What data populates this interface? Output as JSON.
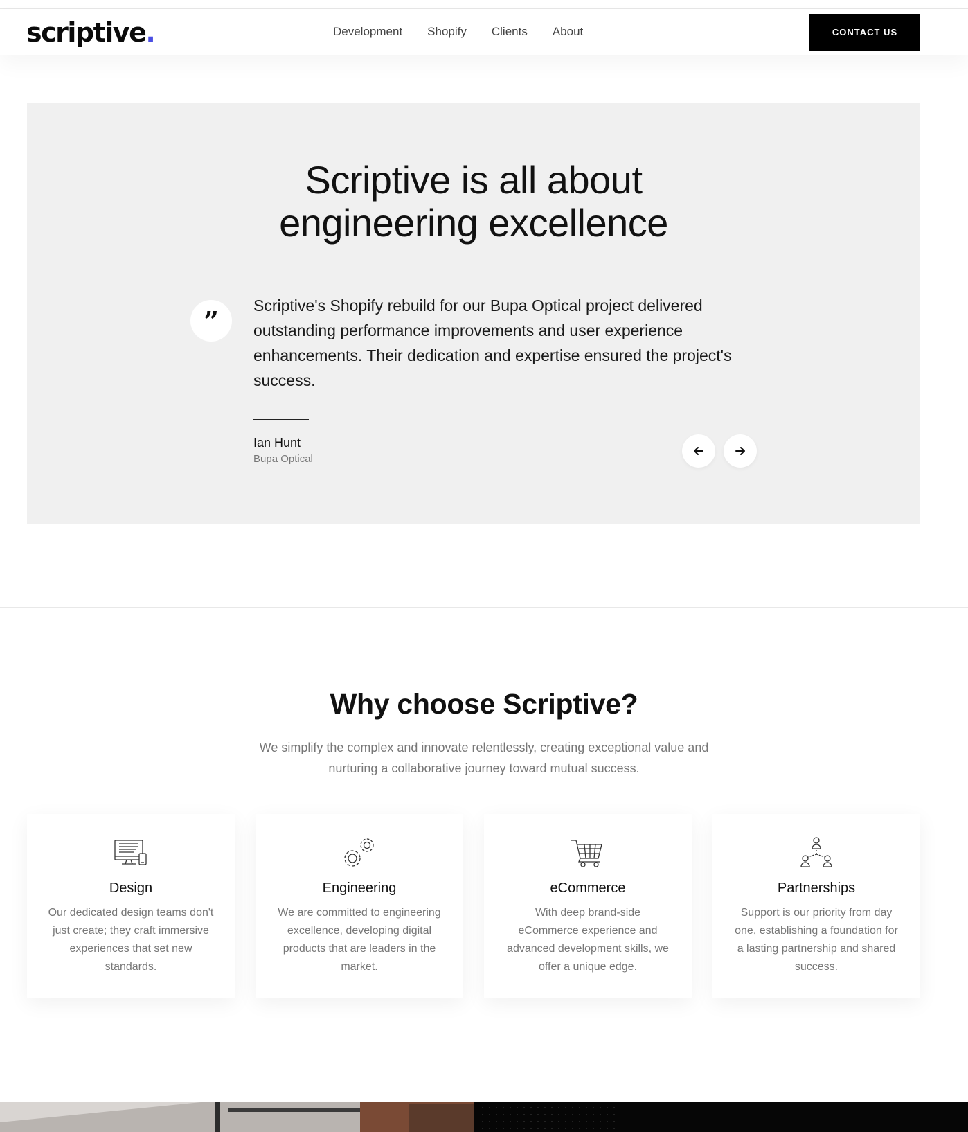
{
  "header": {
    "logo_text": "scriptive",
    "logo_dot": ".",
    "logo_dot_color": "#4b4fe3",
    "nav": [
      "Development",
      "Shopify",
      "Clients",
      "About"
    ],
    "contact_label": "CONTACT US"
  },
  "testimonial": {
    "title_line1": "Scriptive is all about",
    "title_line2": "engineering excellence",
    "quote_mark": "”",
    "quote": "Scriptive's Shopify rebuild for our Bupa Optical project delivered outstanding performance improvements and user experience enhancements. Their dedication and expertise ensured the project's success.",
    "author": "Ian Hunt",
    "company": "Bupa Optical",
    "prev_icon": "arrow-left-icon",
    "next_icon": "arrow-right-icon"
  },
  "why": {
    "title": "Why choose Scriptive?",
    "subtitle": "We simplify the complex and innovate relentlessly, creating exceptional value and nurturing a collaborative journey toward mutual success."
  },
  "cards": [
    {
      "icon": "desktop-mobile-icon",
      "title": "Design",
      "desc": "Our dedicated design teams don't just create; they craft immersive experiences that set new standards."
    },
    {
      "icon": "gears-icon",
      "title": "Engineering",
      "desc": "We are committed to engineering excellence, developing digital products that are leaders in the market."
    },
    {
      "icon": "shopping-cart-icon",
      "title": "eCommerce",
      "desc": "With deep brand-side eCommerce experience and advanced development skills, we offer a unique edge."
    },
    {
      "icon": "people-network-icon",
      "title": "Partnerships",
      "desc": "Support is our priority from day one, establishing a foundation for a lasting partnership and shared success."
    }
  ],
  "colors": {
    "accent": "#4b4fe3",
    "testimonial_bg": "#f0f0f0",
    "button_bg": "#000000"
  }
}
